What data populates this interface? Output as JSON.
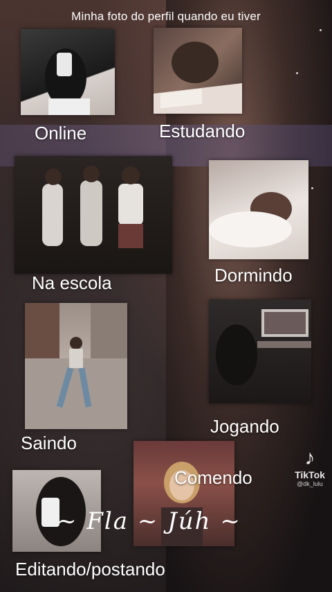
{
  "caption": "Minha foto do perfil quando eu tiver",
  "labels": {
    "online": "Online",
    "estudando": "Estudando",
    "na_escola": "Na escola",
    "dormindo": "Dormindo",
    "saindo": "Saindo",
    "jogando": "Jogando",
    "comendo": "Comendo",
    "editando": "Editando/postando"
  },
  "signature": "~ Fla ~ Júh ~",
  "watermark": {
    "brand": "TikTok",
    "handle": "@dk_lulu"
  },
  "icons": {
    "watermark": "tiktok-logo-icon"
  },
  "colors": {
    "text": "#ffffff",
    "background": "#2a1f1f"
  }
}
